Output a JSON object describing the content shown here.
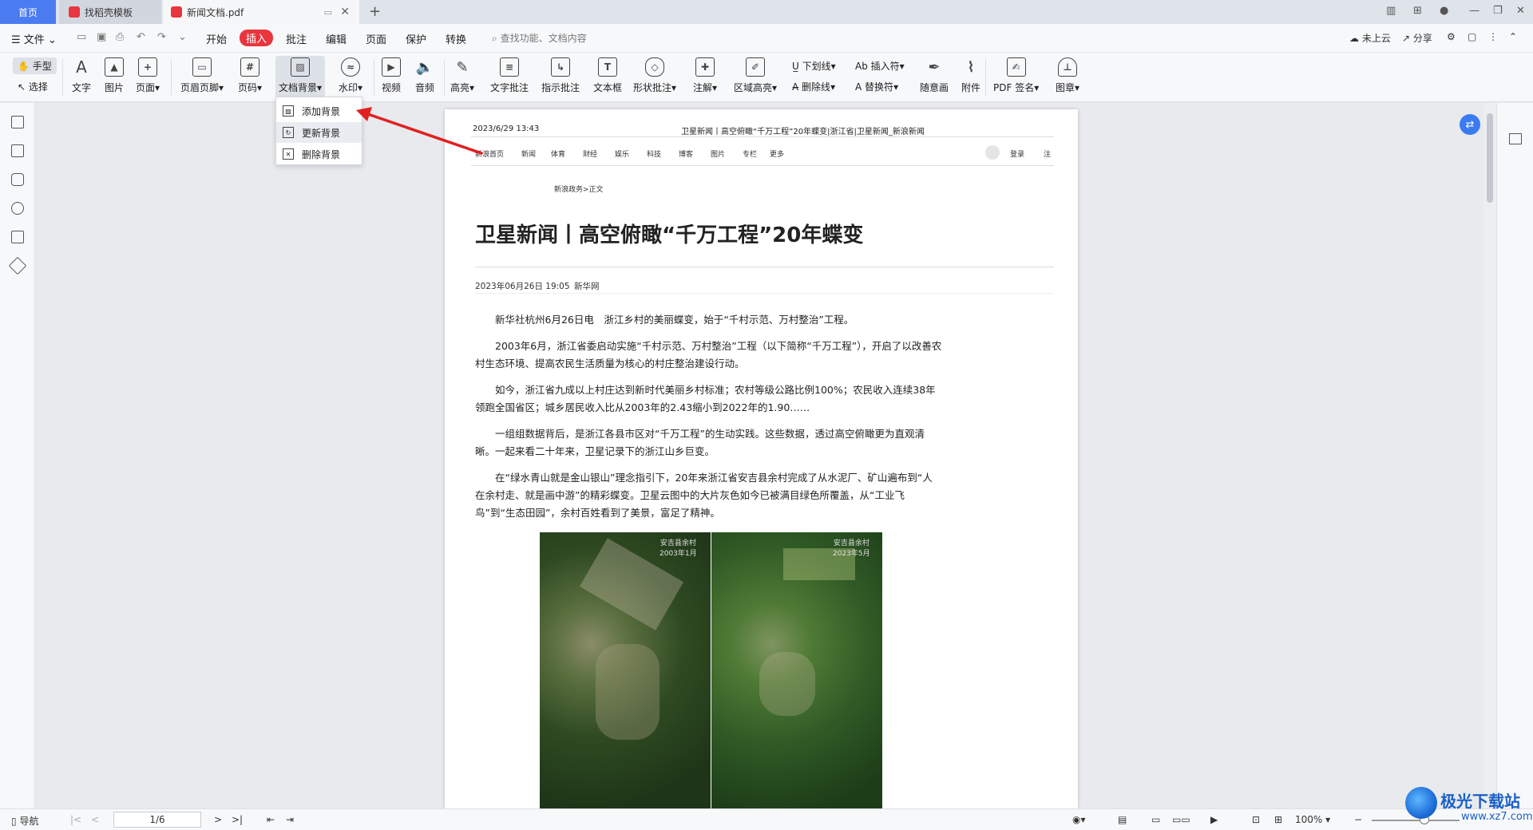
{
  "tabs": {
    "home": "首页",
    "template": "找稻壳模板",
    "pdf": "新闻文档.pdf"
  },
  "menu": {
    "file": "文件",
    "items": [
      "开始",
      "插入",
      "批注",
      "编辑",
      "页面",
      "保护",
      "转换"
    ],
    "active": "插入",
    "search_placeholder": "查找功能、文档内容",
    "cloud": "未上云",
    "share": "分享"
  },
  "ribbon": {
    "hand": "手型",
    "select": "选择",
    "text": "文字",
    "image": "图片",
    "page": "页面",
    "header_footer": "页眉页脚",
    "page_number": "页码",
    "doc_background": "文档背景",
    "watermark": "水印",
    "video": "视频",
    "audio": "音频",
    "highlight": "高亮",
    "text_comment": "文字批注",
    "pointer_comment": "指示批注",
    "textbox": "文本框",
    "shape_comment": "形状批注",
    "annotation": "注解",
    "area_highlight": "区域高亮",
    "underline": "下划线",
    "strikethrough": "删除线",
    "insert_char": "插入符",
    "replace_char": "替换符",
    "freehand": "随意画",
    "attachment": "附件",
    "pdf_sign": "PDF 签名",
    "stamp": "图章"
  },
  "dropdown": {
    "items": [
      "添加背景",
      "更新背景",
      "删除背景"
    ]
  },
  "document": {
    "header_date": "2023/6/29 13:43",
    "header_title": "卫星新闻丨高空俯瞰“千万工程”20年蝶变|浙江省|卫星新闻_新浪新闻",
    "nav": [
      "新浪首页",
      "新闻",
      "体育",
      "财经",
      "娱乐",
      "科技",
      "博客",
      "图片",
      "专栏",
      "更多"
    ],
    "login": "登录",
    "register": "注",
    "breadcrumb": "新浪政务>正文",
    "headline": "卫星新闻丨高空俯瞰“千万工程”20年蝶变",
    "meta_date": "2023年06月26日 19:05",
    "meta_source": "新华网",
    "paragraphs": [
      "新华社杭州6月26日电　浙江乡村的美丽蝶变，始于“千村示范、万村整治”工程。",
      "2003年6月，浙江省委启动实施“千村示范、万村整治”工程（以下简称“千万工程”），开启了以改善农村生态环境、提高农民生活质量为核心的村庄整治建设行动。",
      "如今，浙江省九成以上村庄达到新时代美丽乡村标准；农村等级公路比例100%；农民收入连续38年领跑全国省区；城乡居民收入比从2003年的2.43缩小到2022年的1.90……",
      "一组组数据背后，是浙江各县市区对“千万工程”的生动实践。这些数据，透过高空俯瞰更为直观清晰。一起来看二十年来，卫星记录下的浙江山乡巨变。",
      "在“绿水青山就是金山银山”理念指引下，20年来浙江省安吉县余村完成了从水泥厂、矿山遍布到“人在余村走、就是画中游”的精彩蝶变。卫星云图中的大片灰色如今已被满目绿色所覆盖，从“工业飞鸟”到“生态田园”，余村百姓看到了美景，富足了精神。"
    ],
    "image_labels": [
      "安吉县余村\n2003年1月",
      "安吉县余村\n2023年5月"
    ]
  },
  "status": {
    "nav": "导航",
    "page": "1/6",
    "zoom": "100%"
  },
  "watermark": {
    "brand": "极光下载站",
    "url": "www.xz7.com"
  },
  "colors": {
    "accent": "#e8353e",
    "home_tab": "#4a7bf0",
    "arrow": "#e02020"
  }
}
